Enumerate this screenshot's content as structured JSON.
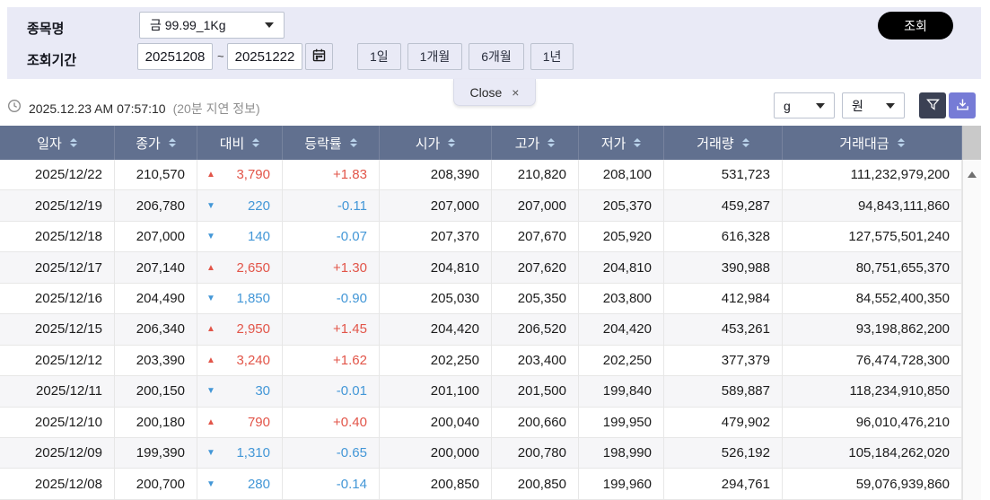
{
  "filters": {
    "item_label": "종목명",
    "item_value": "금 99.99_1Kg",
    "period_label": "조회기간",
    "date_from": "20251208",
    "tilde": "~",
    "date_to": "20251222",
    "period_buttons": [
      "1일",
      "1개월",
      "6개월",
      "1년"
    ],
    "search_button": "조회"
  },
  "tab": {
    "label": "Close",
    "close_symbol": "×"
  },
  "status": {
    "timestamp": "2025.12.23 AM 07:57:10",
    "delay_note": "(20분 지연 정보)"
  },
  "units": {
    "weight": "g",
    "currency": "원"
  },
  "glyphs": {
    "up": "▲",
    "down": "▼"
  },
  "colors": {
    "panel_bg": "#e9eaf6",
    "header_bg": "#61708f",
    "up_red": "#e25549",
    "down_blue": "#4397d7",
    "filter_btn": "#3b4154",
    "download_btn": "#767bd6"
  },
  "table": {
    "headers": [
      "일자",
      "종가",
      "대비",
      "등락률",
      "시가",
      "고가",
      "저가",
      "거래량",
      "거래대금"
    ],
    "rows": [
      {
        "date": "2025/12/22",
        "close": "210,570",
        "dir": "up",
        "change": "3,790",
        "rate": "+1.83",
        "open": "208,390",
        "high": "210,820",
        "low": "208,100",
        "volume": "531,723",
        "value": "111,232,979,200"
      },
      {
        "date": "2025/12/19",
        "close": "206,780",
        "dir": "down",
        "change": "220",
        "rate": "-0.11",
        "open": "207,000",
        "high": "207,000",
        "low": "205,370",
        "volume": "459,287",
        "value": "94,843,111,860"
      },
      {
        "date": "2025/12/18",
        "close": "207,000",
        "dir": "down",
        "change": "140",
        "rate": "-0.07",
        "open": "207,370",
        "high": "207,670",
        "low": "205,920",
        "volume": "616,328",
        "value": "127,575,501,240"
      },
      {
        "date": "2025/12/17",
        "close": "207,140",
        "dir": "up",
        "change": "2,650",
        "rate": "+1.30",
        "open": "204,810",
        "high": "207,620",
        "low": "204,810",
        "volume": "390,988",
        "value": "80,751,655,370"
      },
      {
        "date": "2025/12/16",
        "close": "204,490",
        "dir": "down",
        "change": "1,850",
        "rate": "-0.90",
        "open": "205,030",
        "high": "205,350",
        "low": "203,800",
        "volume": "412,984",
        "value": "84,552,400,350"
      },
      {
        "date": "2025/12/15",
        "close": "206,340",
        "dir": "up",
        "change": "2,950",
        "rate": "+1.45",
        "open": "204,420",
        "high": "206,520",
        "low": "204,420",
        "volume": "453,261",
        "value": "93,198,862,200"
      },
      {
        "date": "2025/12/12",
        "close": "203,390",
        "dir": "up",
        "change": "3,240",
        "rate": "+1.62",
        "open": "202,250",
        "high": "203,400",
        "low": "202,250",
        "volume": "377,379",
        "value": "76,474,728,300"
      },
      {
        "date": "2025/12/11",
        "close": "200,150",
        "dir": "down",
        "change": "30",
        "rate": "-0.01",
        "open": "201,100",
        "high": "201,500",
        "low": "199,840",
        "volume": "589,887",
        "value": "118,234,910,850"
      },
      {
        "date": "2025/12/10",
        "close": "200,180",
        "dir": "up",
        "change": "790",
        "rate": "+0.40",
        "open": "200,040",
        "high": "200,660",
        "low": "199,950",
        "volume": "479,902",
        "value": "96,010,476,210"
      },
      {
        "date": "2025/12/09",
        "close": "199,390",
        "dir": "down",
        "change": "1,310",
        "rate": "-0.65",
        "open": "200,000",
        "high": "200,780",
        "low": "198,990",
        "volume": "526,192",
        "value": "105,184,262,020"
      },
      {
        "date": "2025/12/08",
        "close": "200,700",
        "dir": "down",
        "change": "280",
        "rate": "-0.14",
        "open": "200,850",
        "high": "200,850",
        "low": "199,960",
        "volume": "294,761",
        "value": "59,076,939,860"
      }
    ]
  }
}
